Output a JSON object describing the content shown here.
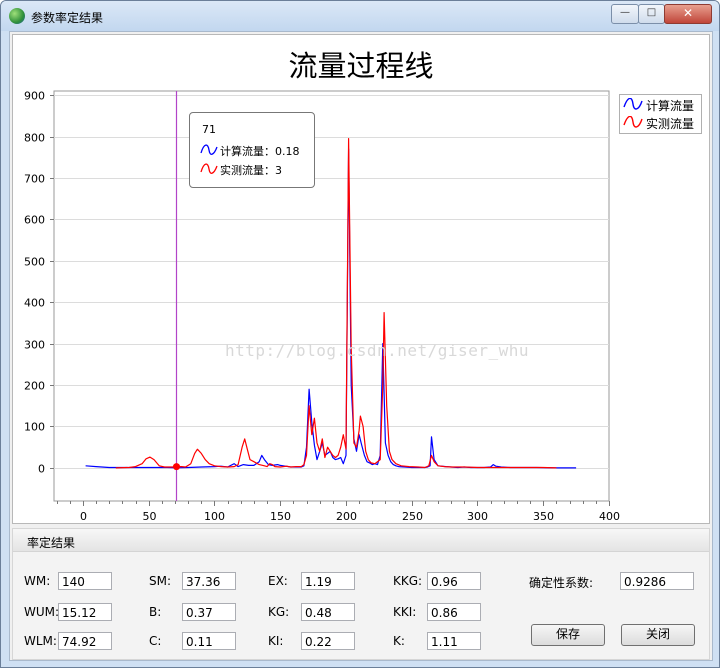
{
  "window": {
    "title": "参数率定结果",
    "minimize_glyph": "—",
    "maximize_glyph": "□",
    "close_glyph": "✕"
  },
  "chart_data": {
    "type": "line",
    "title": "流量过程线",
    "xlim": [
      -22,
      400
    ],
    "ylim": [
      -80,
      910
    ],
    "x_ticks": [
      0,
      50,
      100,
      150,
      200,
      250,
      300,
      350,
      400
    ],
    "y_ticks": [
      0,
      100,
      200,
      300,
      400,
      500,
      600,
      700,
      800,
      900
    ],
    "grid": true,
    "legend_position": "right",
    "series": [
      {
        "name": "计算流量",
        "color": "#0000ff",
        "points": [
          [
            2,
            5
          ],
          [
            10,
            3
          ],
          [
            20,
            1
          ],
          [
            30,
            1
          ],
          [
            40,
            1
          ],
          [
            48,
            1
          ],
          [
            56,
            1
          ],
          [
            64,
            1
          ],
          [
            71,
            0.18
          ],
          [
            80,
            1
          ],
          [
            90,
            2
          ],
          [
            100,
            3
          ],
          [
            105,
            4
          ],
          [
            110,
            2
          ],
          [
            115,
            10
          ],
          [
            118,
            3
          ],
          [
            122,
            8
          ],
          [
            126,
            6
          ],
          [
            130,
            6
          ],
          [
            134,
            15
          ],
          [
            136,
            30
          ],
          [
            138,
            20
          ],
          [
            141,
            8
          ],
          [
            144,
            6
          ],
          [
            148,
            8
          ],
          [
            150,
            6
          ],
          [
            154,
            4
          ],
          [
            158,
            2
          ],
          [
            162,
            2
          ],
          [
            166,
            2
          ],
          [
            168,
            5
          ],
          [
            170,
            50
          ],
          [
            172,
            190
          ],
          [
            174,
            110
          ],
          [
            176,
            55
          ],
          [
            178,
            20
          ],
          [
            180,
            40
          ],
          [
            182,
            60
          ],
          [
            184,
            30
          ],
          [
            186,
            35
          ],
          [
            188,
            40
          ],
          [
            190,
            25
          ],
          [
            192,
            20
          ],
          [
            194,
            22
          ],
          [
            196,
            25
          ],
          [
            198,
            10
          ],
          [
            200,
            30
          ],
          [
            202,
            770
          ],
          [
            204,
            200
          ],
          [
            206,
            70
          ],
          [
            208,
            40
          ],
          [
            210,
            80
          ],
          [
            212,
            55
          ],
          [
            214,
            30
          ],
          [
            216,
            15
          ],
          [
            218,
            12
          ],
          [
            220,
            8
          ],
          [
            222,
            10
          ],
          [
            224,
            8
          ],
          [
            226,
            30
          ],
          [
            228,
            300
          ],
          [
            230,
            60
          ],
          [
            232,
            30
          ],
          [
            234,
            15
          ],
          [
            236,
            8
          ],
          [
            238,
            5
          ],
          [
            240,
            3
          ],
          [
            245,
            2
          ],
          [
            250,
            1
          ],
          [
            255,
            1
          ],
          [
            260,
            1
          ],
          [
            262,
            2
          ],
          [
            264,
            5
          ],
          [
            265,
            75
          ],
          [
            267,
            20
          ],
          [
            270,
            5
          ],
          [
            276,
            3
          ],
          [
            280,
            2
          ],
          [
            285,
            1
          ],
          [
            290,
            2
          ],
          [
            295,
            1
          ],
          [
            300,
            1
          ],
          [
            305,
            1
          ],
          [
            310,
            2
          ],
          [
            312,
            8
          ],
          [
            314,
            4
          ],
          [
            318,
            2
          ],
          [
            325,
            1
          ],
          [
            335,
            1
          ],
          [
            345,
            1
          ],
          [
            360,
            0
          ],
          [
            375,
            0
          ]
        ]
      },
      {
        "name": "实测流量",
        "color": "#ff0000",
        "points": [
          [
            25,
            0
          ],
          [
            35,
            1
          ],
          [
            40,
            3
          ],
          [
            45,
            10
          ],
          [
            48,
            22
          ],
          [
            51,
            26
          ],
          [
            54,
            20
          ],
          [
            58,
            5
          ],
          [
            62,
            2
          ],
          [
            68,
            2
          ],
          [
            71,
            3
          ],
          [
            75,
            3
          ],
          [
            78,
            2
          ],
          [
            82,
            10
          ],
          [
            85,
            35
          ],
          [
            87,
            45
          ],
          [
            90,
            35
          ],
          [
            93,
            20
          ],
          [
            96,
            10
          ],
          [
            100,
            5
          ],
          [
            105,
            3
          ],
          [
            110,
            2
          ],
          [
            115,
            3
          ],
          [
            118,
            8
          ],
          [
            121,
            50
          ],
          [
            123,
            70
          ],
          [
            125,
            45
          ],
          [
            127,
            20
          ],
          [
            130,
            15
          ],
          [
            134,
            8
          ],
          [
            138,
            5
          ],
          [
            140,
            3
          ],
          [
            142,
            10
          ],
          [
            144,
            8
          ],
          [
            146,
            3
          ],
          [
            150,
            2
          ],
          [
            155,
            4
          ],
          [
            158,
            2
          ],
          [
            162,
            3
          ],
          [
            166,
            3
          ],
          [
            168,
            8
          ],
          [
            170,
            30
          ],
          [
            172,
            150
          ],
          [
            174,
            80
          ],
          [
            176,
            120
          ],
          [
            178,
            60
          ],
          [
            180,
            40
          ],
          [
            182,
            70
          ],
          [
            184,
            25
          ],
          [
            186,
            50
          ],
          [
            188,
            40
          ],
          [
            190,
            30
          ],
          [
            192,
            25
          ],
          [
            194,
            30
          ],
          [
            196,
            50
          ],
          [
            198,
            80
          ],
          [
            200,
            45
          ],
          [
            202,
            795
          ],
          [
            204,
            290
          ],
          [
            206,
            60
          ],
          [
            208,
            50
          ],
          [
            210,
            90
          ],
          [
            211,
            125
          ],
          [
            213,
            100
          ],
          [
            215,
            40
          ],
          [
            217,
            20
          ],
          [
            219,
            12
          ],
          [
            222,
            10
          ],
          [
            226,
            20
          ],
          [
            228,
            200
          ],
          [
            229,
            375
          ],
          [
            231,
            150
          ],
          [
            233,
            40
          ],
          [
            235,
            20
          ],
          [
            238,
            10
          ],
          [
            242,
            5
          ],
          [
            248,
            3
          ],
          [
            255,
            2
          ],
          [
            260,
            1
          ],
          [
            263,
            5
          ],
          [
            265,
            30
          ],
          [
            267,
            15
          ],
          [
            270,
            5
          ],
          [
            275,
            3
          ],
          [
            280,
            2
          ],
          [
            290,
            2
          ],
          [
            300,
            1
          ],
          [
            310,
            1
          ],
          [
            320,
            1
          ],
          [
            330,
            1
          ],
          [
            340,
            1
          ],
          [
            350,
            1
          ],
          [
            360,
            0
          ]
        ]
      }
    ],
    "crosshair": {
      "x": 71,
      "label": "71",
      "series_values": [
        "计算流量：0.18",
        "实测流量：3"
      ]
    }
  },
  "watermark": "http://blog.csdn.net/giser_whu",
  "results": {
    "heading": "率定结果",
    "params": [
      {
        "label": "WM:",
        "value": "140"
      },
      {
        "label": "WUM:",
        "value": "15.12"
      },
      {
        "label": "WLM:",
        "value": "74.92"
      },
      {
        "label": "SM:",
        "value": "37.36"
      },
      {
        "label": "B:",
        "value": "0.37"
      },
      {
        "label": "C:",
        "value": "0.11"
      },
      {
        "label": "EX:",
        "value": "1.19"
      },
      {
        "label": "KG:",
        "value": "0.48"
      },
      {
        "label": "KI:",
        "value": "0.22"
      },
      {
        "label": "KKG:",
        "value": "0.96"
      },
      {
        "label": "KKI:",
        "value": "0.86"
      },
      {
        "label": "K:",
        "value": "1.11"
      }
    ],
    "coef_label": "确定性系数:",
    "coef_value": "0.9286",
    "save_label": "保存",
    "close_label": "关闭"
  }
}
